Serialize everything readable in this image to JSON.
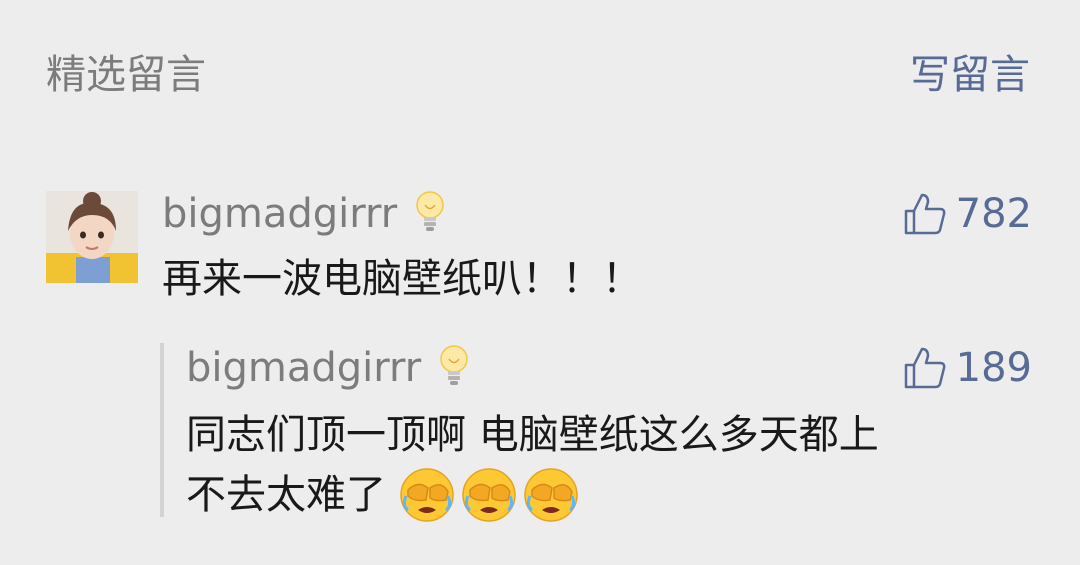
{
  "header": {
    "title": "精选留言",
    "write_label": "写留言"
  },
  "comment": {
    "username": "bigmadgirrr",
    "text": "再来一波电脑壁纸叭！！！",
    "likes": "782"
  },
  "reply": {
    "username": "bigmadgirrr",
    "text_line1": "同志们顶一顶啊 电脑壁纸这么多天都上",
    "text_line2": "不去太难了",
    "likes": "189",
    "emoji_count": 3
  },
  "colors": {
    "background": "#ededed",
    "link": "#576b95",
    "meta": "#7c7c7c",
    "text": "#191919"
  },
  "icons": [
    "thumbs-up-icon",
    "lightbulb-icon",
    "facepalm-cry-emoji",
    "avatar"
  ]
}
